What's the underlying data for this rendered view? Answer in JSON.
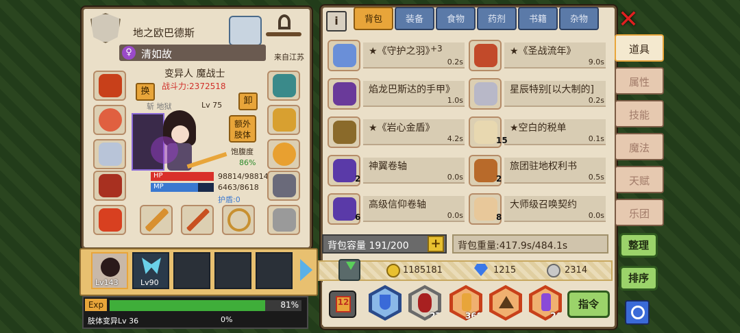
{
  "character": {
    "map_name": "地之欧巴德斯",
    "player_name": "清如故",
    "origin": "来自江苏",
    "class_line": "变异人 魔战士",
    "power": "战斗力:2372518",
    "level_line": "Lv 75",
    "level_prefix": "斩 地狱",
    "swap_label": "换",
    "unequip_label": "卸",
    "extra_limb_label": "额外\n肢体",
    "satiety_label": "饱腹度",
    "satiety_value": "86%",
    "hp_label": "HP",
    "hp_value": "98814/98814",
    "hp_fraction": 1.0,
    "mp_label": "MP",
    "mp_value": "6463/8618",
    "mp_fraction": 0.75,
    "shield": "护盾:0"
  },
  "party": [
    {
      "level": "Lv143"
    },
    {
      "level": "Lv90"
    }
  ],
  "exp": {
    "label": "Exp",
    "percent": "81%",
    "fraction": 0.81,
    "mutation": "肢体变异Lv 36",
    "mutation_percent": "0%"
  },
  "tabs": [
    "背包",
    "装备",
    "食物",
    "药剂",
    "书籍",
    "杂物"
  ],
  "active_tab": 0,
  "side_tabs": [
    "道具",
    "属性",
    "技能",
    "魔法",
    "天赋",
    "乐团"
  ],
  "items": [
    {
      "name": "★《守护之羽》",
      "extra": "+3",
      "time": "0.2s",
      "qty": "",
      "color": "#6a8fd8"
    },
    {
      "name": "★《圣战流年》",
      "extra": "",
      "time": "9.0s",
      "qty": "",
      "color": "#c24a2a"
    },
    {
      "name": "焰龙巴斯达的手甲》",
      "extra": "",
      "time": "1.0s",
      "qty": "",
      "color": "#6a3a9a"
    },
    {
      "name": "星辰特别[以大制的]",
      "extra": "",
      "time": "0.2s",
      "qty": "",
      "color": "#b8b8c8"
    },
    {
      "name": "★《岩心金盾》",
      "extra": "",
      "time": "4.2s",
      "qty": "",
      "color": "#8a6a2a"
    },
    {
      "name": "★空白的税单",
      "extra": "",
      "time": "0.1s",
      "qty": "15",
      "color": "#e8d8b0"
    },
    {
      "name": "神翼卷轴",
      "extra": "",
      "time": "0.0s",
      "qty": "2",
      "color": "#5a3aa8"
    },
    {
      "name": "旅团驻地权利书",
      "extra": "",
      "time": "0.5s",
      "qty": "2",
      "color": "#b86a2a"
    },
    {
      "name": "高级信仰卷轴",
      "extra": "",
      "time": "0.0s",
      "qty": "6",
      "color": "#5a3aa8"
    },
    {
      "name": "大师级召唤契约",
      "extra": "",
      "time": "0.0s",
      "qty": "8",
      "color": "#e8c89a"
    }
  ],
  "bag": {
    "capacity": "背包容量 191/200",
    "weight": "背包重量:417.9s/484.1s"
  },
  "currency": {
    "gold": "1185181",
    "diamond": "1215",
    "silver": "2314"
  },
  "bottom_items": [
    {
      "qty": ""
    },
    {
      "qty": "27"
    },
    {
      "qty": "368"
    },
    {
      "qty": ""
    },
    {
      "qty": "26"
    }
  ],
  "buttons": {
    "command": "指令",
    "sort_items": "整理",
    "order": "排序"
  },
  "colors": {
    "accent_orange": "#e8a53a",
    "green_button": "#9bd36a",
    "hp_red": "#d9302a",
    "mp_blue": "#3a78d0",
    "exp_green": "#3fae3a"
  }
}
